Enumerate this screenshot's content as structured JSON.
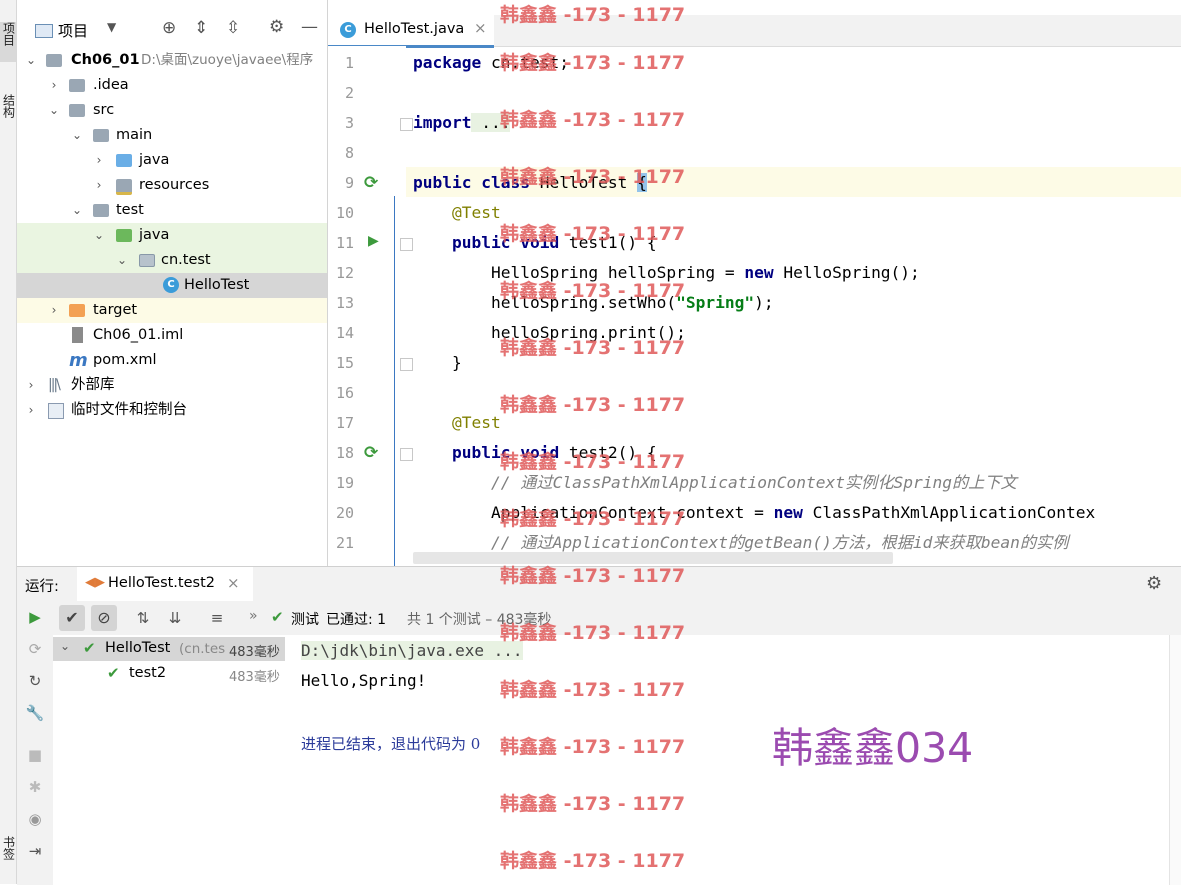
{
  "sidebar_tabs": {
    "project": "项目",
    "structure": "结构",
    "bookmarks": "书签"
  },
  "project_panel": {
    "title": "项目",
    "tree": [
      {
        "label": "Ch06_01",
        "hint": "D:\\桌面\\zuoye\\javaee\\程序"
      },
      {
        "label": ".idea"
      },
      {
        "label": "src"
      },
      {
        "label": "main"
      },
      {
        "label": "java"
      },
      {
        "label": "resources"
      },
      {
        "label": "test"
      },
      {
        "label": "java"
      },
      {
        "label": "cn.test"
      },
      {
        "label": "HelloTest"
      },
      {
        "label": "target"
      },
      {
        "label": "Ch06_01.iml"
      },
      {
        "label": "pom.xml"
      },
      {
        "label": "外部库"
      },
      {
        "label": "临时文件和控制台"
      }
    ]
  },
  "editor": {
    "tab_label": "HelloTest.java",
    "tab_close": "×",
    "line_numbers": [
      "1",
      "2",
      "3",
      "8",
      "9",
      "10",
      "11",
      "12",
      "13",
      "14",
      "15",
      "16",
      "17",
      "18",
      "19",
      "20",
      "21"
    ],
    "code": {
      "l1_kw": "package",
      "l1_rest": " cn.test;",
      "l3_kw": "import",
      "l3_rest": " ...",
      "l9_kw": "public class",
      "l9_rest": " HelloTest ",
      "l9_brace": "{",
      "l10_ann": "@Test",
      "l11_kw": "public void",
      "l11_rest": " test1() {",
      "l12_a": "HelloSpring helloSpring = ",
      "l12_kw": "new",
      "l12_b": " HelloSpring();",
      "l13_a": "helloSpring.setWho(",
      "l13_str": "\"Spring\"",
      "l13_b": ");",
      "l14": "helloSpring.print();",
      "l15": "}",
      "l17_ann": "@Test",
      "l18_kw": "public void",
      "l18_rest": " test2() {",
      "l19_cmt": "// 通过ClassPathXmlApplicationContext实例化Spring的上下文",
      "l20_a": "ApplicationContext context = ",
      "l20_kw": "new",
      "l20_b": " ClassPathXmlApplicationContex",
      "l21_cmt": "// 通过ApplicationContext的getBean()方法，根据id来获取bean的实例"
    }
  },
  "run_panel": {
    "label": "运行:",
    "tab": "HelloTest.test2",
    "tab_close": "×",
    "status_test": "测试",
    "status_passed": "已通过: 1",
    "status_detail": "共 1 个测试 – 483毫秒",
    "tree": [
      {
        "label": "HelloTest",
        "sub": "(cn.tes",
        "time": "483毫秒"
      },
      {
        "label": "test2",
        "time": "483毫秒"
      }
    ],
    "console": {
      "cmd": "D:\\jdk\\bin\\java.exe ...",
      "output": "Hello,Spring!",
      "exit": "进程已结束，退出代码为 0"
    }
  },
  "watermark": {
    "repeat": "韩鑫鑫 -173 - 1177",
    "big": "韩鑫鑫034"
  },
  "colors": {
    "keyword": "#000080",
    "annotation": "#808000",
    "string": "#067d17",
    "comment": "#808080",
    "run_green": "#3d9a3d",
    "watermark": "#e05a5a",
    "big_watermark": "#9b4bb0"
  }
}
